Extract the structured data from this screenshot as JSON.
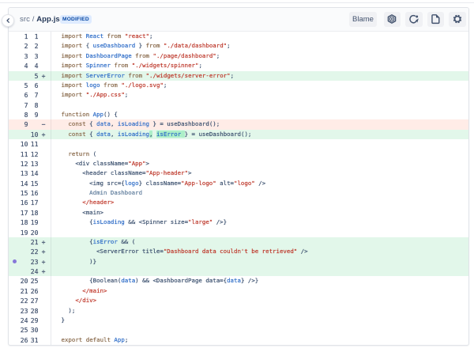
{
  "header": {
    "breadcrumb": {
      "dir": "src",
      "separator": " / ",
      "file": "App.js"
    },
    "status_badge": "MODIFIED",
    "blame_button": "Blame",
    "icon_buttons": [
      "nut-icon",
      "refresh-icon",
      "document-icon",
      "gear-icon"
    ]
  },
  "colors": {
    "added_row_bg": "#E2F7EA",
    "removed_row_bg": "#FFECE7",
    "word_highlight_bg": "#ACEFC8",
    "badge_bg": "#DEEBFF",
    "badge_text": "#0949A3",
    "keyword": "#8B6C4E",
    "identifier": "#2E6DC8",
    "string": "#BE3A2D",
    "comment_dot": "#8777D9"
  },
  "diff": {
    "rows": [
      {
        "old": "1",
        "new": "1",
        "type": "context",
        "tokens": [
          [
            "k",
            "import"
          ],
          [
            "d",
            " "
          ],
          [
            "v",
            "React"
          ],
          [
            "d",
            " "
          ],
          [
            "k",
            "from"
          ],
          [
            "d",
            " "
          ],
          [
            "s",
            "\"react\""
          ],
          [
            "d",
            ";"
          ]
        ]
      },
      {
        "old": "2",
        "new": "2",
        "type": "context",
        "tokens": [
          [
            "k",
            "import"
          ],
          [
            "d",
            " { "
          ],
          [
            "v",
            "useDashboard"
          ],
          [
            "d",
            " } "
          ],
          [
            "k",
            "from"
          ],
          [
            "d",
            " "
          ],
          [
            "s",
            "\"./data/dashboard\""
          ],
          [
            "d",
            ";"
          ]
        ]
      },
      {
        "old": "3",
        "new": "3",
        "type": "context",
        "tokens": [
          [
            "k",
            "import"
          ],
          [
            "d",
            " "
          ],
          [
            "v",
            "DashboardPage"
          ],
          [
            "d",
            " "
          ],
          [
            "k",
            "from"
          ],
          [
            "d",
            " "
          ],
          [
            "s",
            "\"./page/dashboard\""
          ],
          [
            "d",
            ";"
          ]
        ]
      },
      {
        "old": "4",
        "new": "4",
        "type": "context",
        "tokens": [
          [
            "k",
            "import"
          ],
          [
            "d",
            " "
          ],
          [
            "v",
            "Spinner"
          ],
          [
            "d",
            " "
          ],
          [
            "k",
            "from"
          ],
          [
            "d",
            " "
          ],
          [
            "s",
            "\"./widgets/spinner\""
          ],
          [
            "d",
            ";"
          ]
        ]
      },
      {
        "old": "",
        "new": "5",
        "type": "add",
        "tokens": [
          [
            "k",
            "import"
          ],
          [
            "d",
            " "
          ],
          [
            "v",
            "ServerError"
          ],
          [
            "d",
            " "
          ],
          [
            "k",
            "from"
          ],
          [
            "d",
            " "
          ],
          [
            "s",
            "\"./widgets/server-error\""
          ],
          [
            "d",
            ";"
          ]
        ]
      },
      {
        "old": "5",
        "new": "6",
        "type": "context",
        "tokens": [
          [
            "k",
            "import"
          ],
          [
            "d",
            " "
          ],
          [
            "v",
            "logo"
          ],
          [
            "d",
            " "
          ],
          [
            "k",
            "from"
          ],
          [
            "d",
            " "
          ],
          [
            "s",
            "\"./logo.svg\""
          ],
          [
            "d",
            ";"
          ]
        ]
      },
      {
        "old": "6",
        "new": "7",
        "type": "context",
        "tokens": [
          [
            "k",
            "import"
          ],
          [
            "d",
            " "
          ],
          [
            "s",
            "\"./App.css\""
          ],
          [
            "d",
            ";"
          ]
        ]
      },
      {
        "old": "7",
        "new": "8",
        "type": "context",
        "tokens": []
      },
      {
        "old": "8",
        "new": "9",
        "type": "context",
        "tokens": [
          [
            "k",
            "function"
          ],
          [
            "d",
            " "
          ],
          [
            "v",
            "App"
          ],
          [
            "d",
            "() {"
          ]
        ]
      },
      {
        "old": "9",
        "new": "",
        "type": "del",
        "tokens": [
          [
            "d",
            "  "
          ],
          [
            "k",
            "const"
          ],
          [
            "d",
            " { "
          ],
          [
            "v",
            "data"
          ],
          [
            "d",
            ", "
          ],
          [
            "v",
            "isLoading"
          ],
          [
            "d",
            " } = useDashboard();"
          ]
        ]
      },
      {
        "old": "",
        "new": "10",
        "type": "add",
        "tokens": [
          [
            "d",
            "  "
          ],
          [
            "k",
            "const"
          ],
          [
            "d",
            " { "
          ],
          [
            "v",
            "data"
          ],
          [
            "d",
            ", "
          ],
          [
            "v",
            "isLoading"
          ],
          [
            "d",
            ",",
            "m"
          ],
          [
            "d",
            " "
          ],
          [
            "v",
            "isError",
            "m"
          ],
          [
            "d",
            " ",
            "m"
          ],
          [
            "d",
            "} = useDashboard();"
          ]
        ]
      },
      {
        "old": "10",
        "new": "11",
        "type": "context",
        "tokens": []
      },
      {
        "old": "11",
        "new": "12",
        "type": "context",
        "tokens": [
          [
            "d",
            "  "
          ],
          [
            "k",
            "return"
          ],
          [
            "d",
            " ("
          ]
        ]
      },
      {
        "old": "12",
        "new": "13",
        "type": "context",
        "tokens": [
          [
            "d",
            "    <div className="
          ],
          [
            "s",
            "\"App\""
          ],
          [
            "d",
            ">"
          ]
        ]
      },
      {
        "old": "13",
        "new": "14",
        "type": "context",
        "tokens": [
          [
            "d",
            "      <header className="
          ],
          [
            "s",
            "\"App-header\""
          ],
          [
            "d",
            ">"
          ]
        ]
      },
      {
        "old": "14",
        "new": "15",
        "type": "context",
        "tokens": [
          [
            "d",
            "        <img src={"
          ],
          [
            "v",
            "logo"
          ],
          [
            "d",
            "} className="
          ],
          [
            "s",
            "\"App-logo\""
          ],
          [
            "d",
            " alt="
          ],
          [
            "s",
            "\"logo\""
          ],
          [
            "d",
            " />"
          ]
        ]
      },
      {
        "old": "15",
        "new": "16",
        "type": "context",
        "tokens": [
          [
            "p",
            "        Admin Dashboard"
          ]
        ]
      },
      {
        "old": "16",
        "new": "17",
        "type": "context",
        "tokens": [
          [
            "d",
            "      "
          ],
          [
            "t",
            "</header>"
          ]
        ]
      },
      {
        "old": "17",
        "new": "18",
        "type": "context",
        "tokens": [
          [
            "d",
            "      <main>"
          ]
        ]
      },
      {
        "old": "18",
        "new": "19",
        "type": "context",
        "tokens": [
          [
            "d",
            "        {"
          ],
          [
            "v",
            "isLoading"
          ],
          [
            "d",
            " && <Spinner size="
          ],
          [
            "s",
            "\"large\""
          ],
          [
            "d",
            " />}"
          ]
        ]
      },
      {
        "old": "19",
        "new": "20",
        "type": "context",
        "tokens": []
      },
      {
        "old": "",
        "new": "21",
        "type": "add",
        "tokens": [
          [
            "d",
            "        {"
          ],
          [
            "v",
            "isError"
          ],
          [
            "d",
            " && ("
          ]
        ]
      },
      {
        "old": "",
        "new": "22",
        "type": "add",
        "tokens": [
          [
            "d",
            "          <ServerError title="
          ],
          [
            "s",
            "\"Dashboard data couldn't be retrieved\""
          ],
          [
            "d",
            " />"
          ]
        ]
      },
      {
        "old": "",
        "new": "23",
        "type": "add",
        "dot": true,
        "tokens": [
          [
            "d",
            "        )}"
          ]
        ]
      },
      {
        "old": "",
        "new": "24",
        "type": "add",
        "tokens": []
      },
      {
        "old": "20",
        "new": "25",
        "type": "context",
        "tokens": [
          [
            "d",
            "        {Boolean("
          ],
          [
            "v",
            "data"
          ],
          [
            "d",
            ") && <DashboardPage data={"
          ],
          [
            "v",
            "data"
          ],
          [
            "d",
            "} />}"
          ]
        ]
      },
      {
        "old": "21",
        "new": "26",
        "type": "context",
        "tokens": [
          [
            "d",
            "      "
          ],
          [
            "t",
            "</main>"
          ]
        ]
      },
      {
        "old": "22",
        "new": "27",
        "type": "context",
        "tokens": [
          [
            "d",
            "    "
          ],
          [
            "t",
            "</div>"
          ]
        ]
      },
      {
        "old": "23",
        "new": "28",
        "type": "context",
        "tokens": [
          [
            "d",
            "  );"
          ]
        ]
      },
      {
        "old": "24",
        "new": "29",
        "type": "context",
        "tokens": [
          [
            "d",
            "}"
          ]
        ]
      },
      {
        "old": "25",
        "new": "30",
        "type": "context",
        "tokens": []
      },
      {
        "old": "26",
        "new": "31",
        "type": "context",
        "tokens": [
          [
            "k",
            "export"
          ],
          [
            "d",
            " "
          ],
          [
            "k",
            "default"
          ],
          [
            "d",
            " "
          ],
          [
            "v",
            "App"
          ],
          [
            "d",
            ";"
          ]
        ]
      }
    ]
  }
}
